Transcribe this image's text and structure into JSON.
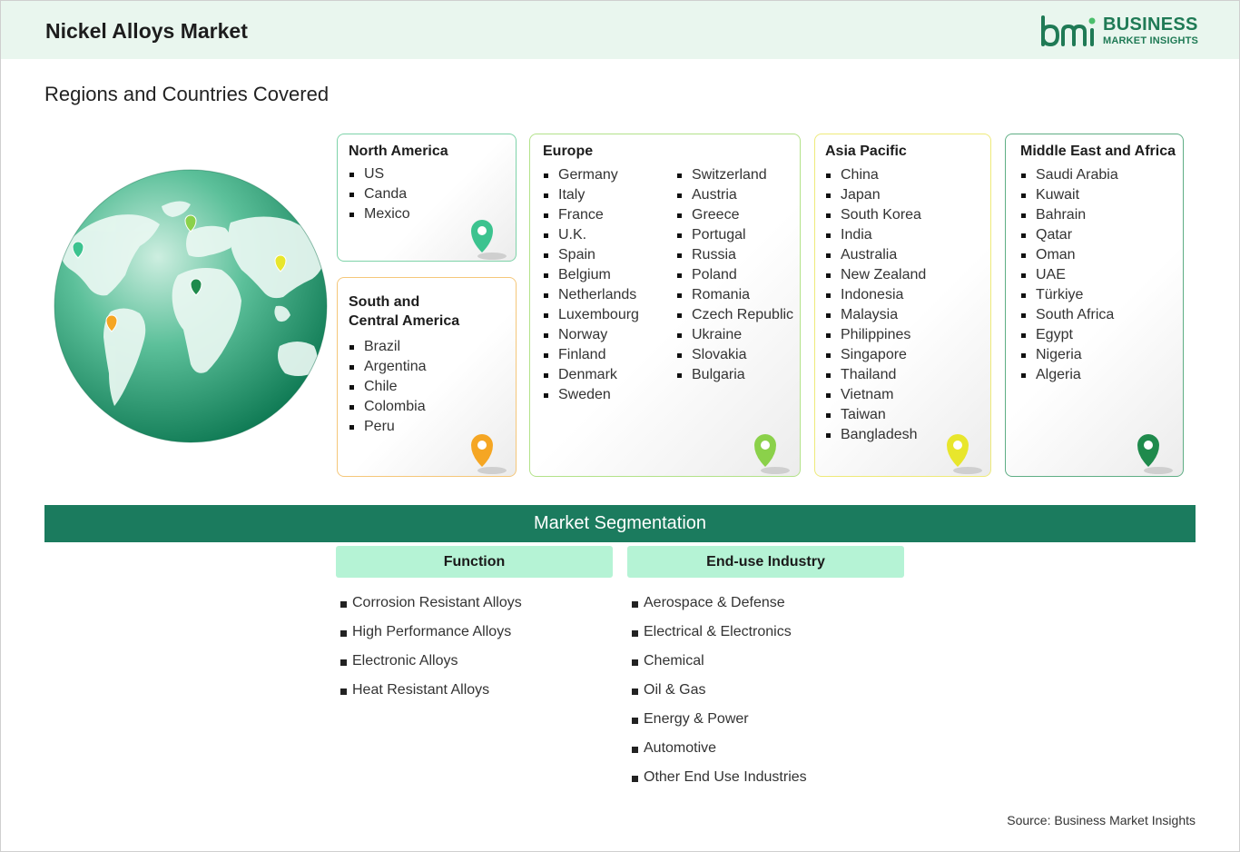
{
  "header": {
    "title": "Nickel Alloys Market"
  },
  "logo": {
    "line1": "BUSINESS",
    "line2": "MARKET INSIGHTS"
  },
  "regions_title": "Regions and Countries Covered",
  "regions": {
    "north_america": {
      "title": "North America",
      "countries": [
        "US",
        "Canda",
        "Mexico"
      ],
      "pin_color": "#3cc38f"
    },
    "south_central_america": {
      "title_line1": "South and",
      "title_line2": "Central America",
      "countries": [
        "Brazil",
        "Argentina",
        "Chile",
        "Colombia",
        "Peru"
      ],
      "pin_color": "#f5a623"
    },
    "europe": {
      "title": "Europe",
      "col1": [
        "Germany",
        "Italy",
        "France",
        "U.K.",
        "Spain",
        "Belgium",
        "Netherlands",
        "Luxembourg",
        "Norway",
        "Finland",
        "Denmark",
        "Sweden"
      ],
      "col2": [
        "Switzerland",
        "Austria",
        "Greece",
        "Portugal",
        "Russia",
        "Poland",
        "Romania",
        "Czech Republic",
        "Ukraine",
        "Slovakia",
        "Bulgaria"
      ],
      "pin_color": "#8bd14a"
    },
    "asia_pacific": {
      "title": "Asia Pacific",
      "countries": [
        "China",
        "Japan",
        "South Korea",
        "India",
        "Australia",
        "New Zealand",
        "Indonesia",
        "Malaysia",
        "Philippines",
        "Singapore",
        "Thailand",
        "Vietnam",
        "Taiwan",
        "Bangladesh"
      ],
      "pin_color": "#e8e62c"
    },
    "mea": {
      "title": "Middle East and Africa",
      "countries": [
        "Saudi Arabia",
        "Kuwait",
        "Bahrain",
        "Qatar",
        "Oman",
        "UAE",
        "Türkiye",
        "South Africa",
        "Egypt",
        "Nigeria",
        "Algeria"
      ],
      "pin_color": "#1f8a4c"
    }
  },
  "segmentation": {
    "title": "Market Segmentation",
    "function": {
      "title": "Function",
      "items": [
        "Corrosion Resistant Alloys",
        "High Performance Alloys",
        "Electronic Alloys",
        "Heat Resistant Alloys"
      ]
    },
    "end_use": {
      "title": "End-use Industry",
      "items": [
        "Aerospace & Defense",
        "Electrical & Electronics",
        "Chemical",
        "Oil & Gas",
        "Energy & Power",
        "Automotive",
        "Other End Use Industries"
      ]
    }
  },
  "source": "Source: Business Market Insights",
  "colors": {
    "accent": "#1b7b5e",
    "header_bg": "#e9f6ee",
    "seg_head_bg": "#b5f3d5"
  }
}
